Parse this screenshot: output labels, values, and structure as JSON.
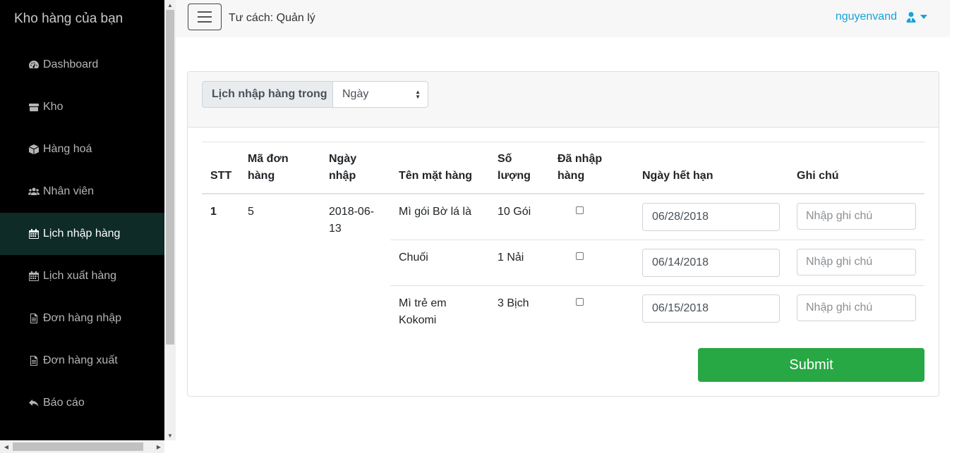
{
  "sidebar": {
    "brand": "Kho hàng của bạn",
    "items": [
      {
        "label": "Dashboard",
        "icon": "tachometer-icon"
      },
      {
        "label": "Kho",
        "icon": "archive-icon"
      },
      {
        "label": "Hàng hoá",
        "icon": "cube-icon"
      },
      {
        "label": "Nhân viên",
        "icon": "users-icon"
      },
      {
        "label": "Lịch nhập hàng",
        "icon": "calendar-icon",
        "active": true
      },
      {
        "label": "Lịch xuất hàng",
        "icon": "calendar-icon"
      },
      {
        "label": "Đơn hàng nhập",
        "icon": "file-icon"
      },
      {
        "label": "Đơn hàng xuất",
        "icon": "file-icon"
      },
      {
        "label": "Báo cáo",
        "icon": "reply-icon"
      }
    ]
  },
  "topbar": {
    "role": "Tư cách: Quản lý",
    "username": "nguyenvand",
    "user_icon": "user-tie-icon"
  },
  "filter": {
    "label": "Lịch nhập hàng trong",
    "selected": "Ngày"
  },
  "table": {
    "headers": {
      "stt": "STT",
      "ma_line1": "Mã đơn",
      "ma_line2": "hàng",
      "ngay_line1": "Ngày",
      "ngay_line2": "nhập",
      "ten": "Tên mặt hàng",
      "so_line1": "Số",
      "so_line2": "lượng",
      "da_line1": "Đã nhập",
      "da_line2": "hàng",
      "het_han": "Ngày hết hạn",
      "ghi_chu": "Ghi chú"
    },
    "order": {
      "stt": "1",
      "ma": "5",
      "ngay_line1": "2018-06-",
      "ngay_line2": "13"
    },
    "rows": [
      {
        "name_line1": "Mì gói Bờ lá là",
        "name_line2": "",
        "qty": "10 Gói",
        "expiry": "06/28/2018",
        "note_placeholder": "Nhập ghi chú"
      },
      {
        "name_line1": "Chuối",
        "name_line2": "",
        "qty": "1 Nải",
        "expiry": "06/14/2018",
        "note_placeholder": "Nhập ghi chú"
      },
      {
        "name_line1": "Mì trẻ em",
        "name_line2": "Kokomi",
        "qty": "3 Bịch",
        "expiry": "06/15/2018",
        "note_placeholder": "Nhập ghi chú"
      }
    ]
  },
  "submit_label": "Submit",
  "colors": {
    "sidebar_bg": "#000000",
    "sidebar_active": "#0e2b27",
    "accent": "#17a2d8",
    "submit": "#28a745"
  }
}
